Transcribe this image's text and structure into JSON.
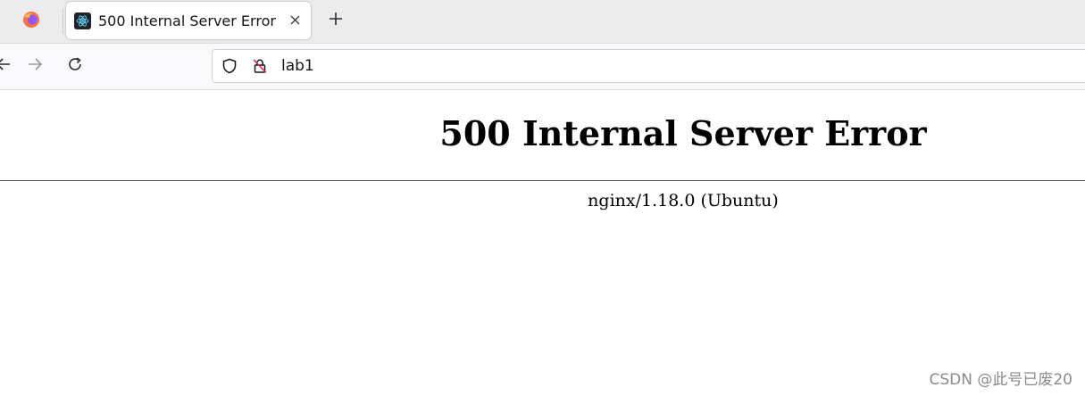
{
  "browser": {
    "tabs": [
      {
        "title": "500 Internal Server Error",
        "favicon": "react-icon",
        "active": true
      }
    ],
    "url": "lab1",
    "colors": {
      "firefox_orange": "#ff7139",
      "firefox_purple": "#9059ff",
      "favicon_cyan": "#61dafb",
      "tracking_red": "#e22850"
    }
  },
  "page": {
    "heading": "500 Internal Server Error",
    "server": "nginx/1.18.0 (Ubuntu)"
  },
  "watermark": "CSDN @此号已废20"
}
